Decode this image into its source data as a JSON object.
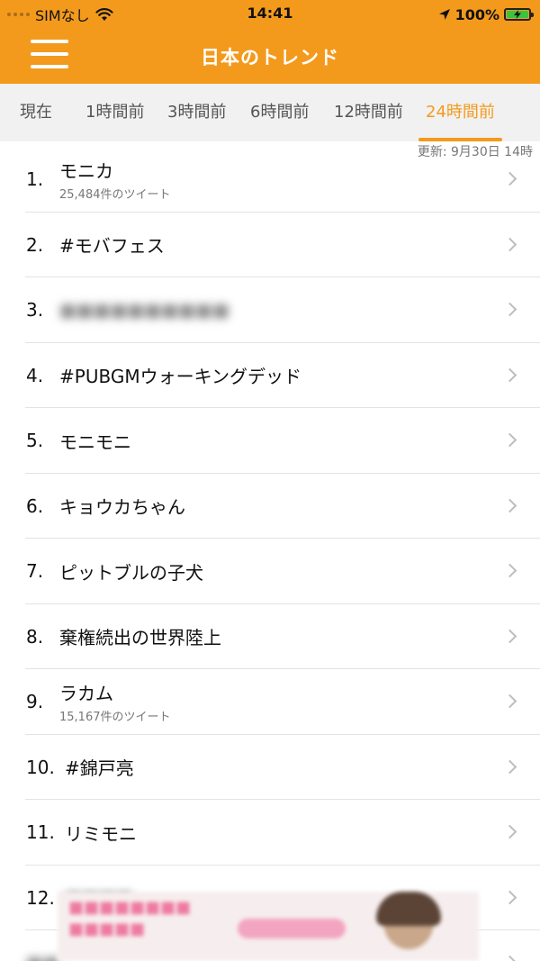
{
  "status_bar": {
    "carrier": "SIMなし",
    "time": "14:41",
    "battery": "100%",
    "icons": [
      "signal-dots-icon",
      "wifi-icon",
      "location-arrow-icon",
      "battery-charging-icon"
    ]
  },
  "header": {
    "title": "日本のトレンド",
    "menu_icon": "hamburger-menu-icon",
    "background": "#f39a1d"
  },
  "tabs": [
    {
      "label": "現在",
      "active": false
    },
    {
      "label": "1時間前",
      "active": false
    },
    {
      "label": "3時間前",
      "active": false
    },
    {
      "label": "6時間前",
      "active": false
    },
    {
      "label": "12時間前",
      "active": false
    },
    {
      "label": "24時間前",
      "active": true
    }
  ],
  "updated_label": "更新: 9月30日 14時",
  "trends": [
    {
      "rank": "1.",
      "name": "モニカ",
      "tweets": "25,484件のツイート"
    },
    {
      "rank": "2.",
      "name": "#モバフェス"
    },
    {
      "rank": "3.",
      "name": "",
      "blurred": true
    },
    {
      "rank": "4.",
      "name": "#PUBGMウォーキングデッド"
    },
    {
      "rank": "5.",
      "name": "モニモニ"
    },
    {
      "rank": "6.",
      "name": "キョウカちゃん"
    },
    {
      "rank": "7.",
      "name": "ピットブルの子犬"
    },
    {
      "rank": "8.",
      "name": "棄権続出の世界陸上"
    },
    {
      "rank": "9.",
      "name": "ラカム",
      "tweets": "15,167件のツイート"
    },
    {
      "rank": "10.",
      "name": "#錦戸亮"
    },
    {
      "rank": "11.",
      "name": "リミモニ"
    },
    {
      "rank": "12.",
      "name": "",
      "blurred": true
    }
  ],
  "accent_color": "#f39a1d",
  "advertisement": {
    "obscured": true
  }
}
